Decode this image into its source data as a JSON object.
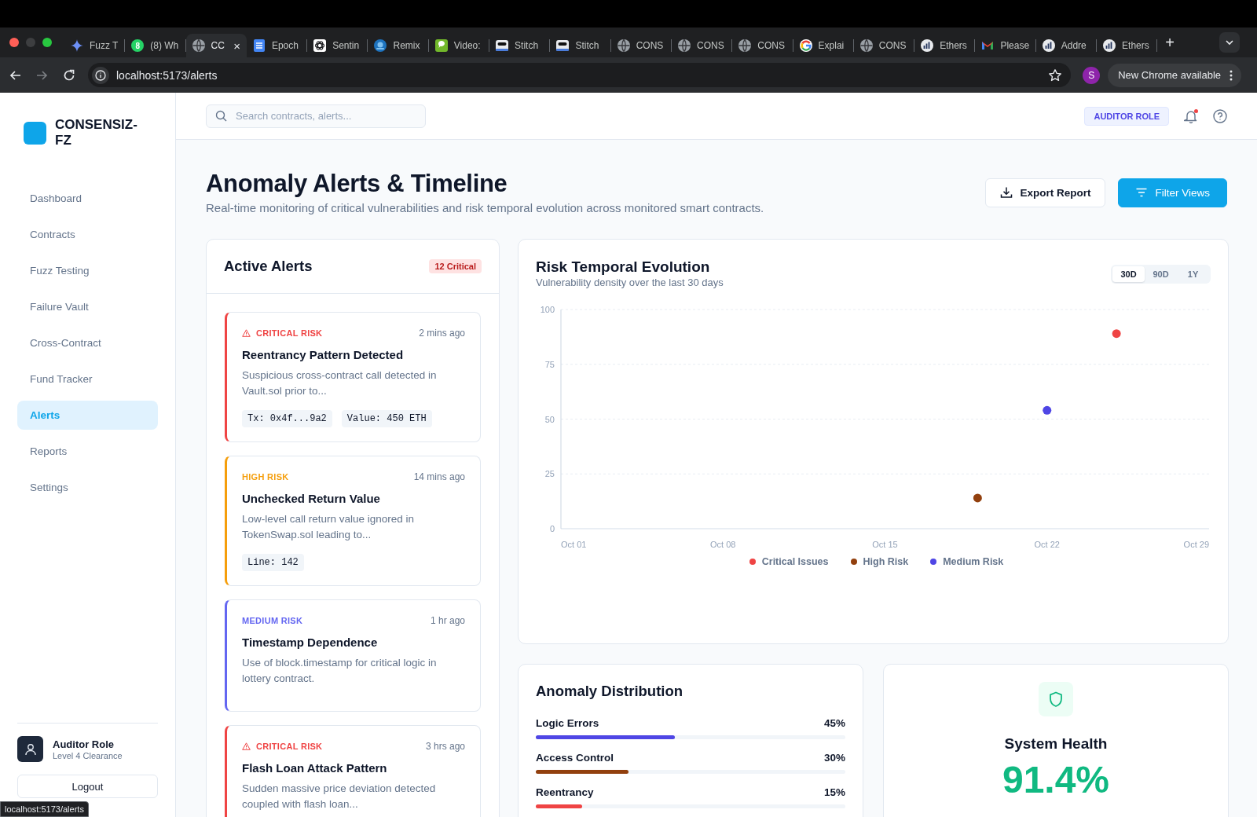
{
  "browser": {
    "tabs": [
      {
        "title": "Fuzz T",
        "kind": "sparkle",
        "selected": false
      },
      {
        "title": "(8) Wh",
        "kind": "chat",
        "badge": "8",
        "selected": false
      },
      {
        "title": "CC",
        "kind": "globe",
        "selected": true,
        "close": "×"
      },
      {
        "title": "Epoch",
        "kind": "doc",
        "selected": false
      },
      {
        "title": "Sentin",
        "kind": "knot",
        "selected": false
      },
      {
        "title": "Remix",
        "kind": "disc",
        "selected": false
      },
      {
        "title": "Video:",
        "kind": "bubble",
        "selected": false
      },
      {
        "title": "Stitch",
        "kind": "robot",
        "selected": false
      },
      {
        "title": "Stitch",
        "kind": "robot",
        "selected": false
      },
      {
        "title": "CONS",
        "kind": "globe",
        "selected": false
      },
      {
        "title": "CONS",
        "kind": "globe",
        "selected": false
      },
      {
        "title": "CONS",
        "kind": "globe",
        "selected": false
      },
      {
        "title": "Explai",
        "kind": "ring",
        "selected": false
      },
      {
        "title": "CONS",
        "kind": "globe",
        "selected": false
      },
      {
        "title": "Ethers",
        "kind": "chart",
        "selected": false
      },
      {
        "title": "Please",
        "kind": "mail",
        "selected": false
      },
      {
        "title": "Addre",
        "kind": "chart",
        "selected": false
      },
      {
        "title": "Ethers",
        "kind": "chart",
        "selected": false
      }
    ],
    "new_tab": "+",
    "url": "localhost:5173/alerts",
    "profile": "S",
    "update_button": "New Chrome available"
  },
  "sidebar": {
    "logo": "CONSENSIZ-FZ",
    "items": [
      {
        "label": "Dashboard",
        "selected": false
      },
      {
        "label": "Contracts",
        "selected": false
      },
      {
        "label": "Fuzz Testing",
        "selected": false
      },
      {
        "label": "Failure Vault",
        "selected": false
      },
      {
        "label": "Cross-Contract",
        "selected": false
      },
      {
        "label": "Fund Tracker",
        "selected": false
      },
      {
        "label": "Alerts",
        "selected": true
      },
      {
        "label": "Reports",
        "selected": false
      },
      {
        "label": "Settings",
        "selected": false
      }
    ],
    "user": {
      "name": "Auditor Role",
      "clearance": "Level 4 Clearance"
    },
    "logout": "Logout"
  },
  "topbar": {
    "search": {
      "placeholder": "Search contracts, alerts..."
    },
    "role_badge": "AUDITOR ROLE",
    "notification_dot": true
  },
  "header": {
    "title": "Anomaly Alerts & Timeline",
    "subtitle": "Real-time monitoring of critical vulnerabilities and risk temporal evolution across monitored smart contracts.",
    "buttons": [
      {
        "label": "Export Report",
        "kind": "secondary"
      },
      {
        "label": "Filter Views",
        "kind": "primary"
      }
    ]
  },
  "alerts": {
    "title": "Active Alerts",
    "badge": "12 Critical",
    "items": [
      {
        "kind": "critical",
        "label": "CRITICAL RISK",
        "time": "2 mins ago",
        "title": "Reentrancy Pattern Detected",
        "description": "Suspicious cross-contract call detected in Vault.sol prior to...",
        "tags": [
          "Tx: 0x4f...9a2",
          "Value: 450 ETH"
        ]
      },
      {
        "kind": "high",
        "label": "HIGH RISK",
        "time": "14 mins ago",
        "title": "Unchecked Return Value",
        "description": "Low-level call return value ignored in TokenSwap.sol leading to...",
        "tags": [
          "Line: 142"
        ]
      },
      {
        "kind": "medium",
        "label": "MEDIUM RISK",
        "time": "1 hr ago",
        "title": "Timestamp Dependence",
        "description": "Use of block.timestamp for critical logic in lottery contract."
      },
      {
        "kind": "critical",
        "label": "CRITICAL RISK",
        "time": "3 hrs ago",
        "title": "Flash Loan Attack Pattern",
        "description": "Sudden massive price deviation detected coupled with flash loan..."
      }
    ]
  },
  "timeline": {
    "title": "Risk Temporal Evolution",
    "subtitle": "Vulnerability density over the last 30 days",
    "ranges": [
      {
        "label": "30D",
        "selected": true
      },
      {
        "label": "90D",
        "selected": false
      },
      {
        "label": "1Y",
        "selected": false
      }
    ],
    "chart_data": {
      "type": "scatter",
      "categories": [
        "Oct 01",
        null,
        null,
        null,
        null,
        null,
        null,
        "Oct 08",
        null,
        null,
        null,
        null,
        null,
        null,
        "Oct 15",
        null,
        null,
        null,
        null,
        null,
        null,
        "Oct 22",
        null,
        null,
        null,
        null,
        null,
        null,
        "Oct 29"
      ],
      "series": [
        {
          "name": "Critical Issues",
          "color": "#ef4444",
          "values": [
            null,
            null,
            null,
            null,
            null,
            null,
            null,
            null,
            null,
            null,
            null,
            null,
            null,
            null,
            null,
            null,
            null,
            null,
            null,
            null,
            null,
            null,
            null,
            null,
            89,
            null,
            null,
            null,
            null
          ]
        },
        {
          "name": "High Risk",
          "color": "#92400e",
          "values": [
            null,
            null,
            null,
            null,
            null,
            null,
            null,
            null,
            null,
            null,
            null,
            null,
            null,
            null,
            null,
            null,
            null,
            null,
            14,
            null,
            null,
            null,
            null,
            null,
            null,
            null,
            null,
            null,
            null
          ]
        },
        {
          "name": "Medium Risk",
          "color": "#4f46e5",
          "values": [
            null,
            null,
            null,
            null,
            null,
            null,
            null,
            null,
            null,
            null,
            null,
            null,
            null,
            null,
            null,
            null,
            null,
            null,
            null,
            null,
            null,
            54,
            null,
            null,
            null,
            null,
            null,
            null,
            null
          ]
        }
      ],
      "ylim": [
        0,
        100
      ],
      "yticks": [
        0,
        25,
        50,
        75,
        100
      ],
      "grid": true
    }
  },
  "distribution": {
    "title": "Anomaly Distribution",
    "rows": [
      {
        "label": "Logic Errors",
        "reading": "45%",
        "level": 0.45,
        "color": "#4f46e5"
      },
      {
        "label": "Access Control",
        "reading": "30%",
        "level": 0.3,
        "color": "#92400e"
      },
      {
        "label": "Reentrancy",
        "reading": "15%",
        "level": 0.15,
        "color": "#ef4444"
      }
    ]
  },
  "health": {
    "title": "System Health",
    "value": "91.4%"
  },
  "status_bubble": "localhost:5173/alerts"
}
